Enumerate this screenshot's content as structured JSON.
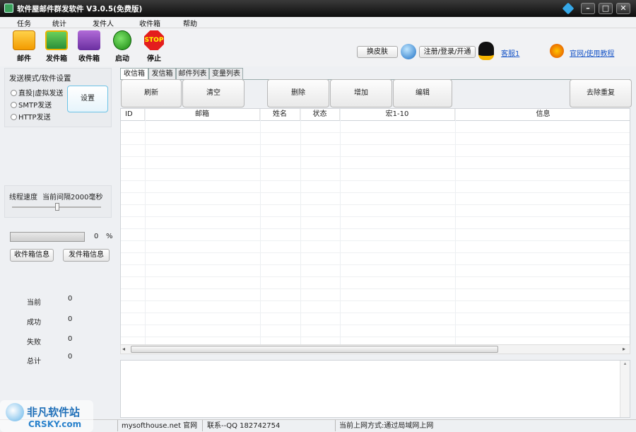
{
  "window": {
    "title": "软件屋邮件群发软件 V3.0.5(免费版)",
    "buttons": [
      "?",
      "–",
      "□",
      "✕"
    ]
  },
  "menu": [
    "任务",
    "统计",
    "发件人",
    "收件箱",
    "帮助"
  ],
  "toolbar": [
    {
      "label": "邮件",
      "icon": "mail-icon"
    },
    {
      "label": "发件箱",
      "icon": "outbox-icon"
    },
    {
      "label": "收件箱",
      "icon": "inbox-icon"
    },
    {
      "label": "启动",
      "icon": "start-icon"
    },
    {
      "label": "停止",
      "icon": "stop-icon",
      "icon_text": "STOP"
    }
  ],
  "topright": {
    "skin": "换皮肤",
    "register": "注册/登录/开通",
    "service": "客服1",
    "website": "官网/使用教程"
  },
  "left": {
    "send_mode_title": "发送模式/软件设置",
    "modes": [
      "直投|虚拟发送",
      "SMTP发送",
      "HTTP发送"
    ],
    "settings_button": "设置",
    "thread_label": "线程速度",
    "interval_text": "当前间隔2000毫秒",
    "progress_value": "0",
    "progress_unit": "%",
    "inbox_info": "收件箱信息",
    "outbox_info": "发件箱信息",
    "stats": [
      {
        "label": "当前",
        "value": "0"
      },
      {
        "label": "成功",
        "value": "0"
      },
      {
        "label": "失败",
        "value": "0"
      },
      {
        "label": "总计",
        "value": "0"
      }
    ]
  },
  "tabs": [
    "收信箱",
    "发信箱",
    "邮件列表",
    "变量列表"
  ],
  "actions": [
    "刷新",
    "清空",
    "删除",
    "增加",
    "编辑",
    "去除重复"
  ],
  "columns": [
    "ID",
    "邮箱",
    "姓名",
    "状态",
    "宏1-10",
    "信息"
  ],
  "status": {
    "site": "mysofthouse.net 官网",
    "contact": "联系--QQ 182742754",
    "network": "当前上网方式:通过局域网上网"
  },
  "watermark": {
    "brand": "非凡软件站",
    "domain": "CRSKY.com"
  }
}
